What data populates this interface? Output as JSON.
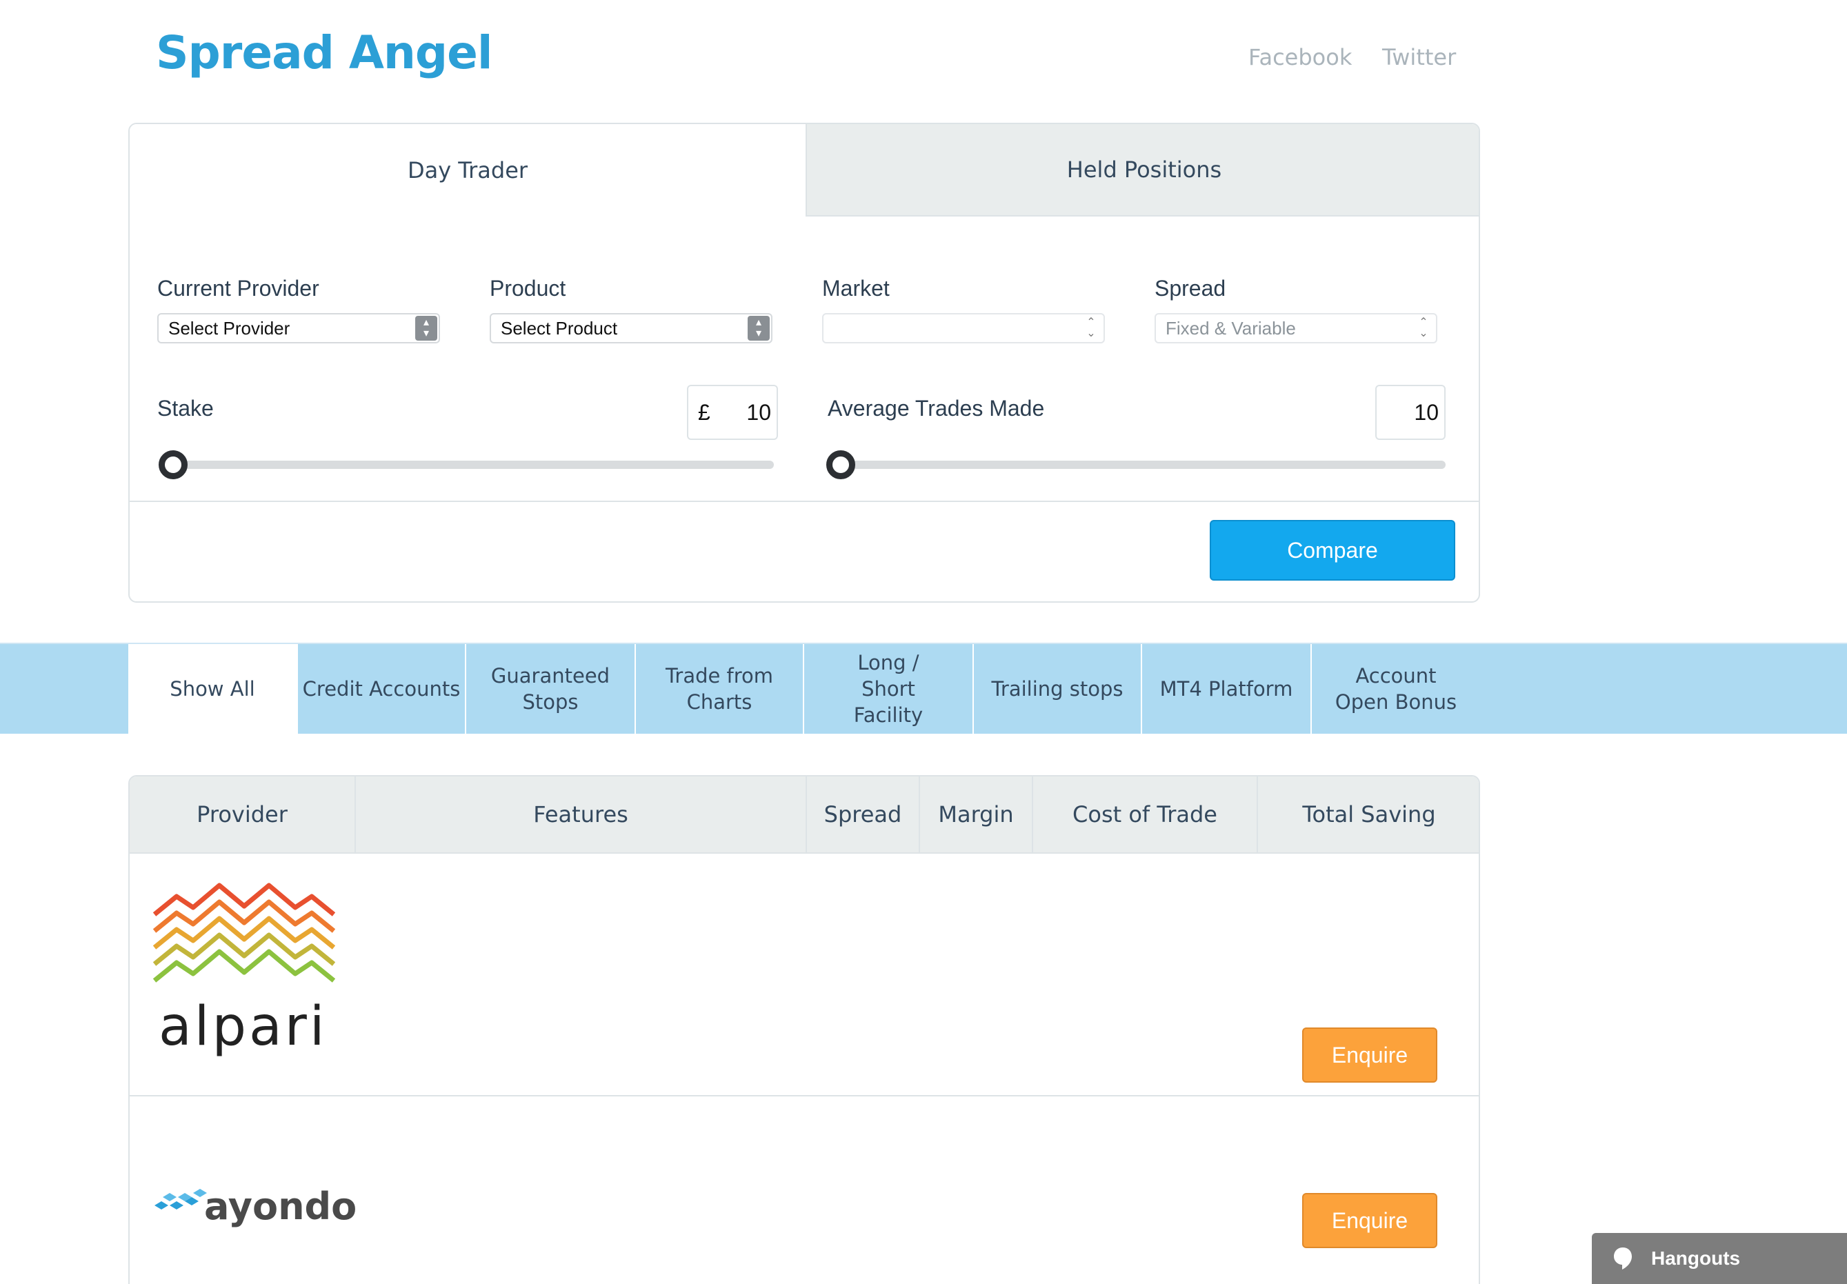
{
  "header": {
    "brand": "Spread Angel",
    "links": [
      "Facebook",
      "Twitter"
    ]
  },
  "mode_tabs": [
    "Day Trader",
    "Held Positions"
  ],
  "form": {
    "provider": {
      "label": "Current Provider",
      "value": "Select Provider"
    },
    "product": {
      "label": "Product",
      "value": "Select Product"
    },
    "market": {
      "label": "Market",
      "value": ""
    },
    "spread": {
      "label": "Spread",
      "value": "Fixed & Variable"
    },
    "stake": {
      "label": "Stake",
      "currency": "£",
      "value": "10",
      "slider_level": 0
    },
    "trades": {
      "label": "Average Trades Made",
      "value": "10",
      "slider_level": 0
    },
    "compare_label": "Compare"
  },
  "filters": [
    "Show All",
    "Credit Accounts",
    "Guaranteed Stops",
    "Trade from Charts",
    "Long / Short Facility",
    "Trailing stops",
    "MT4 Platform",
    "Account Open Bonus"
  ],
  "table": {
    "headers": [
      "Provider",
      "Features",
      "Spread",
      "Margin",
      "Cost of Trade",
      "Total Saving"
    ],
    "rows": [
      {
        "provider": "alpari",
        "action": "Enquire"
      },
      {
        "provider": "ayondo",
        "action": "Enquire"
      }
    ]
  },
  "hangouts": {
    "label": "Hangouts"
  },
  "colors": {
    "brand": "#2c9fd6",
    "compare": "#13a8ee",
    "enquire": "#fca23b",
    "filter_bar": "#addaf2"
  }
}
